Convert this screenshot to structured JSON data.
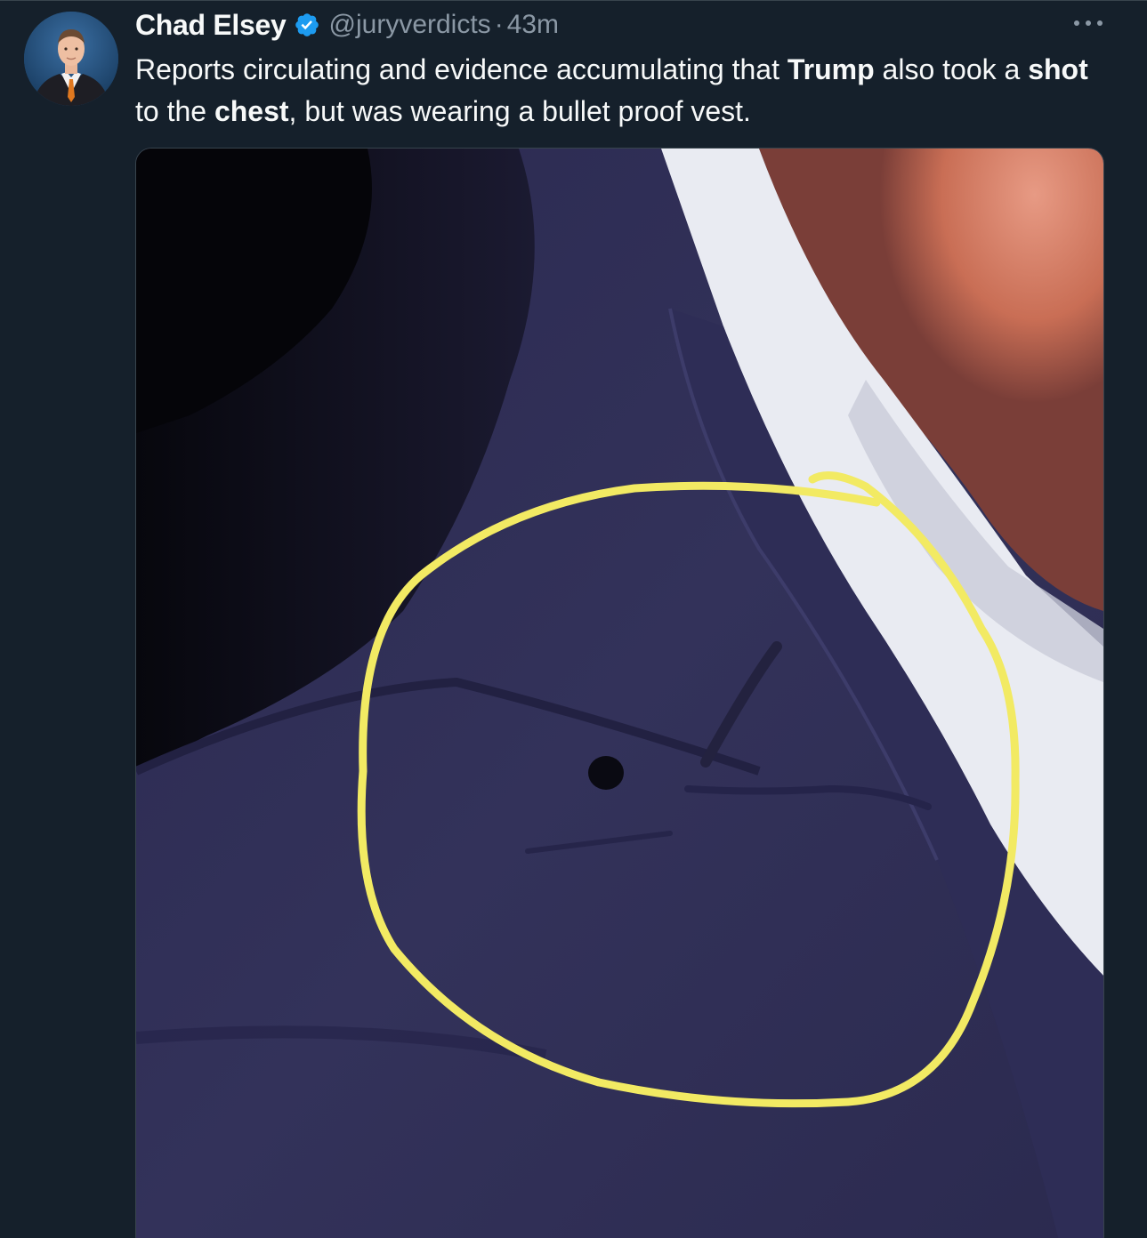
{
  "tweet": {
    "author_name": "Chad Elsey",
    "author_handle": "@juryverdicts",
    "separator": "·",
    "timestamp": "43m",
    "text_segments": [
      {
        "text": "Reports circulating and evidence accumulating that ",
        "bold": false
      },
      {
        "text": "Trump",
        "bold": true
      },
      {
        "text": " also took a ",
        "bold": false
      },
      {
        "text": "shot",
        "bold": true
      },
      {
        "text": " to the ",
        "bold": false
      },
      {
        "text": "chest",
        "bold": true
      },
      {
        "text": ", but was wearing a bullet proof vest.",
        "bold": false
      }
    ]
  },
  "icons": {
    "verified": "verified-badge-icon",
    "more": "more-options-icon"
  },
  "colors": {
    "background": "#15202b",
    "text_primary": "#f7f9f9",
    "text_secondary": "#8b98a5",
    "verified_blue": "#1d9bf0",
    "annotation_yellow": "#f2ea63",
    "suit_navy": "#302f55"
  }
}
